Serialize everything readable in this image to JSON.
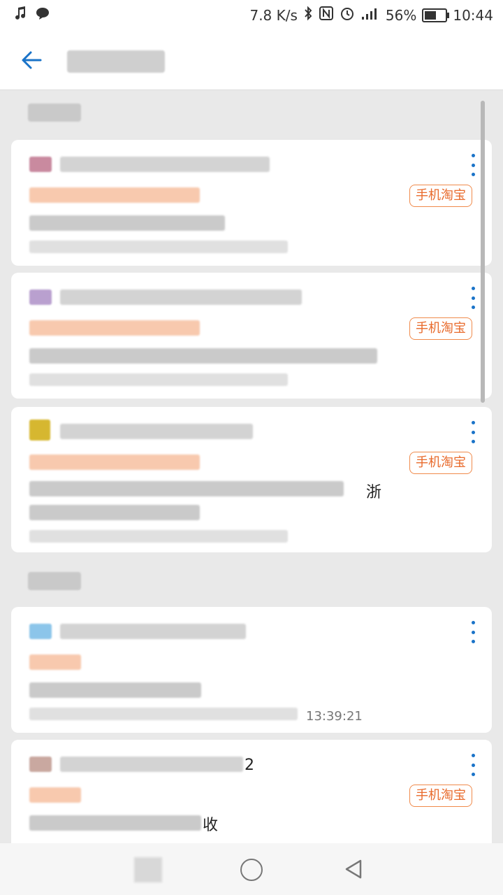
{
  "status_bar": {
    "network_speed": "7.8 K/s",
    "battery_percent": "56%",
    "time": "10:44",
    "battery_level": 0.56,
    "left_icons": [
      "music-note-icon",
      "chat-bubble-icon"
    ],
    "right_icons": [
      "bluetooth-icon",
      "nfc-icon",
      "alarm-icon",
      "signal-4g-icon",
      "battery-icon"
    ]
  },
  "app_bar": {
    "title": "",
    "back_icon": "arrow-left-icon",
    "accent_color": "#1a73c8"
  },
  "sections": [
    {
      "label": "",
      "cards": [
        {
          "sender": "",
          "subject": "",
          "body": "",
          "body_fragment": "",
          "meta": "",
          "app_badge": "手机淘宝"
        },
        {
          "sender": "",
          "subject": "",
          "body": "",
          "body_fragment": "",
          "meta": "",
          "app_badge": "手机淘宝"
        },
        {
          "sender": "",
          "subject": "",
          "body": "",
          "body_fragment": "浙",
          "meta": "",
          "app_badge": "手机淘宝"
        }
      ]
    },
    {
      "label": "",
      "cards": [
        {
          "sender": "",
          "subject": "",
          "body": "",
          "meta": "",
          "time": "13:39:21",
          "app_badge": ""
        },
        {
          "sender": "",
          "sender_suffix": "2",
          "subject": "",
          "body": "",
          "body_fragment": "收",
          "meta": "",
          "app_badge": "手机淘宝"
        }
      ]
    }
  ],
  "nav_bar": {
    "icons": [
      "recents-square-icon",
      "home-circle-icon",
      "back-triangle-icon"
    ]
  },
  "colors": {
    "badge_orange": "#e8692a",
    "more_dots_blue": "#1a73c8",
    "blurred_subject": "#f8c9ae"
  }
}
